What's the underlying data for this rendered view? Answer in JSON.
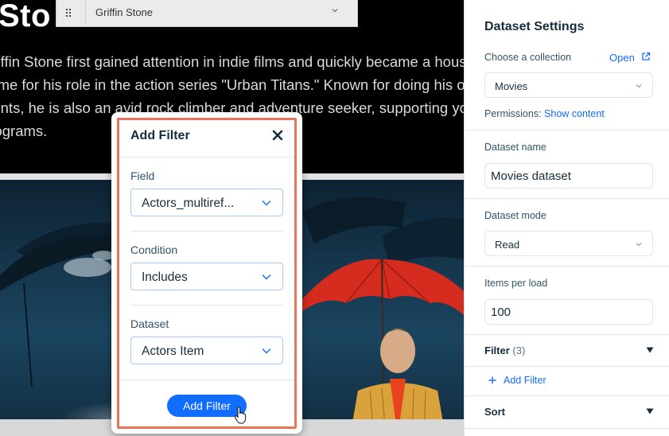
{
  "canvas": {
    "title": "Sto",
    "bio_lines": [
      "Griffin Stone first gained attention in indie films and quickly became a household",
      "name for his role in the action series \"Urban Titans.\" Known for doing his own",
      "stunts, he is also an avid rock climber and adventure seeker, supporting youth",
      "programs."
    ]
  },
  "element_toolbar": {
    "selected_item": "Griffin Stone"
  },
  "add_filter_popup": {
    "title": "Add Filter",
    "field": {
      "label": "Field",
      "value": "Actors_multiref..."
    },
    "condition": {
      "label": "Condition",
      "value": "Includes"
    },
    "dataset": {
      "label": "Dataset",
      "value": "Actors Item"
    },
    "submit_label": "Add Filter"
  },
  "dataset_settings": {
    "title": "Dataset Settings",
    "collection_label": "Choose a collection",
    "open_label": "Open",
    "collection_value": "Movies",
    "permissions_label": "Permissions:",
    "permissions_link": "Show content",
    "name_label": "Dataset name",
    "name_value": "Movies dataset",
    "mode_label": "Dataset mode",
    "mode_value": "Read",
    "items_label": "Items per load",
    "items_value": "100",
    "filter_section": "Filter",
    "filter_count": "(3)",
    "add_filter_label": "Add Filter",
    "sort_section": "Sort"
  },
  "colors": {
    "accent": "#116dff",
    "highlight": "#e8735a",
    "umbrella": "#d62b1f"
  },
  "icons": [
    "drag-handle-icon",
    "chevron-down-icon",
    "close-icon",
    "external-link-icon",
    "plus-icon",
    "triangle-down-icon",
    "hand-cursor-icon"
  ]
}
